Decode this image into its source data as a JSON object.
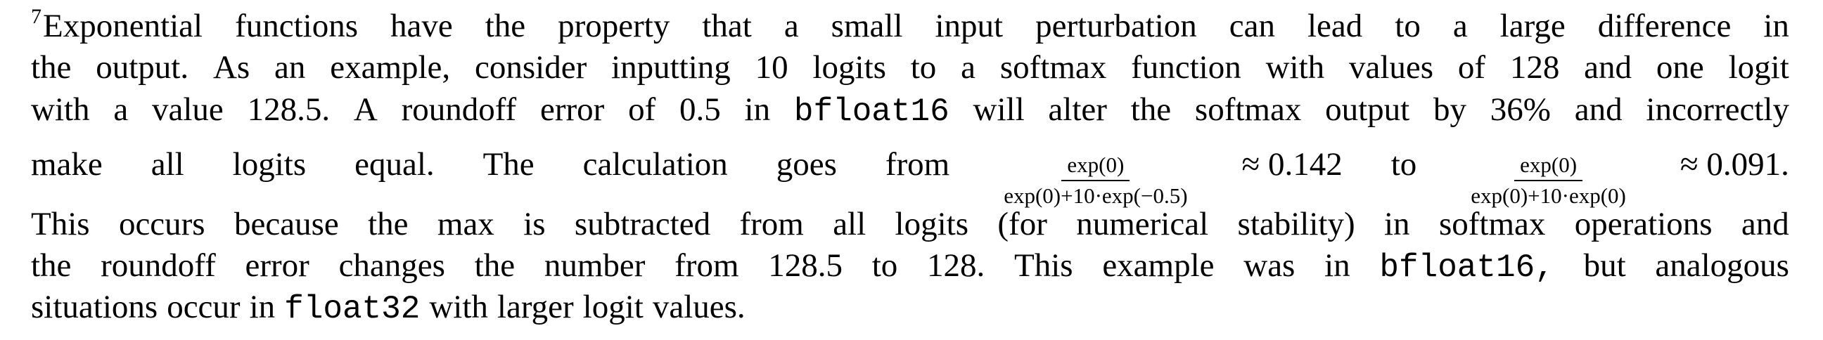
{
  "footnote": {
    "marker": "7",
    "line1": {
      "w1": "Exponential",
      "w2": "functions",
      "w3": "have",
      "w4": "the",
      "w5": "property",
      "w6": "that",
      "w7": "a",
      "w8": "small",
      "w9": "input",
      "w10": "perturbation",
      "w11": "can",
      "w12": "lead",
      "w13": "to",
      "w14": "a",
      "w15": "large",
      "w16": "difference",
      "w17": "in"
    },
    "line2": {
      "w1": "the",
      "w2": "output.",
      "w3": "As",
      "w4": "an",
      "w5": "example,",
      "w6": "consider",
      "w7": "inputting",
      "w8": "10",
      "w9": "logits",
      "w10": "to",
      "w11": "a",
      "w12": "softmax",
      "w13": "function",
      "w14": "with",
      "w15": "values",
      "w16": "of",
      "w17": "128",
      "w18": "and",
      "w19": "one",
      "w20": "logit"
    },
    "line3": {
      "w1": "with",
      "w2": "a",
      "w3": "value",
      "w4": "128.5.",
      "w5": "A",
      "w6": "roundoff",
      "w7": "error",
      "w8": "of",
      "w9": "0.5",
      "w10": "in",
      "code1": "bfloat16",
      "w11": "will",
      "w12": "alter",
      "w13": "the",
      "w14": "softmax",
      "w15": "output",
      "w16": "by",
      "w17": "36%",
      "w18": "and",
      "w19": "incorrectly"
    },
    "line4": {
      "w1": "make",
      "w2": "all",
      "w3": "logits",
      "w4": "equal.",
      "w5": "The",
      "w6": "calculation",
      "w7": "goes",
      "w8": "from",
      "frac1_num": "exp(0)",
      "frac1_den": "exp(0)+10·exp(−0.5)",
      "approx1": "≈ 0.142",
      "w9": "to",
      "frac2_num": "exp(0)",
      "frac2_den": "exp(0)+10·exp(0)",
      "approx2": "≈ 0.091."
    },
    "line5": {
      "w1": "This",
      "w2": "occurs",
      "w3": "because",
      "w4": "the",
      "w5": "max",
      "w6": "is",
      "w7": "subtracted",
      "w8": "from",
      "w9": "all",
      "w10": "logits",
      "w11": "(for",
      "w12": "numerical",
      "w13": "stability)",
      "w14": "in",
      "w15": "softmax",
      "w16": "operations",
      "w17": "and"
    },
    "line6": {
      "w1": "the",
      "w2": "roundoff",
      "w3": "error",
      "w4": "changes",
      "w5": "the",
      "w6": "number",
      "w7": "from",
      "w8": "128.5",
      "w9": "to",
      "w10": "128.",
      "w11": "This",
      "w12": "example",
      "w13": "was",
      "w14": "in",
      "code1": "bfloat16,",
      "w15": "but",
      "w16": "analogous"
    },
    "line7": {
      "w1": "situations",
      "w2": "occur",
      "w3": "in",
      "code1": "float32",
      "w4": "with",
      "w5": "larger",
      "w6": "logit",
      "w7": "values."
    }
  }
}
